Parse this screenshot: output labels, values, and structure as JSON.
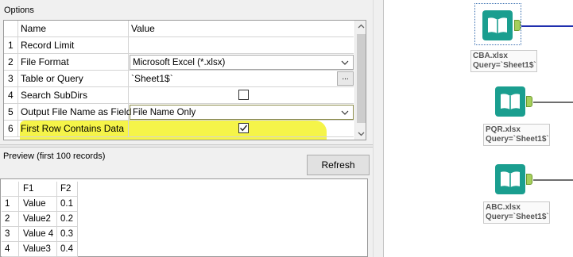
{
  "options": {
    "title": "Options",
    "columns": {
      "name": "Name",
      "value": "Value"
    },
    "rows": [
      {
        "num": "1",
        "name": "Record Limit",
        "value": ""
      },
      {
        "num": "2",
        "name": "File Format",
        "value": "Microsoft Excel (*.xlsx)"
      },
      {
        "num": "3",
        "name": "Table or Query",
        "value": "`Sheet1$`",
        "button": "..."
      },
      {
        "num": "4",
        "name": "Search SubDirs",
        "checked": false
      },
      {
        "num": "5",
        "name": "Output File Name as Field",
        "value": "File Name Only"
      },
      {
        "num": "6",
        "name": "First Row Contains Data",
        "checked": true
      }
    ]
  },
  "preview": {
    "title": "Preview (first 100 records)",
    "refresh_label": "Refresh",
    "columns": [
      "F1",
      "F2"
    ],
    "rows": [
      {
        "num": "1",
        "f1": "Value",
        "f2": "0.1"
      },
      {
        "num": "2",
        "f1": "Value2",
        "f2": "0.2"
      },
      {
        "num": "3",
        "f1": "Value 4",
        "f2": "0.3"
      },
      {
        "num": "4",
        "f1": "Value3",
        "f2": "0.4"
      }
    ]
  },
  "canvas": {
    "tools": [
      {
        "file": "CBA.xlsx",
        "query": "Query=`Sheet1$`",
        "selected": true
      },
      {
        "file": "PQR.xlsx",
        "query": "Query=`Sheet1$`",
        "selected": false
      },
      {
        "file": "ABC.xlsx",
        "query": "Query=`Sheet1$`",
        "selected": false
      }
    ]
  },
  "colors": {
    "tool_icon": "#1a9e8f",
    "anchor": "#a6cf5b",
    "highlight": "#f4f33a",
    "selected_connection": "#1f2fae",
    "connection": "#6e6e6e"
  },
  "icons": [
    "book-icon",
    "chevron-down-icon",
    "ellipsis-icon",
    "checkmark-icon",
    "scroll-up-icon",
    "scroll-down-icon"
  ]
}
